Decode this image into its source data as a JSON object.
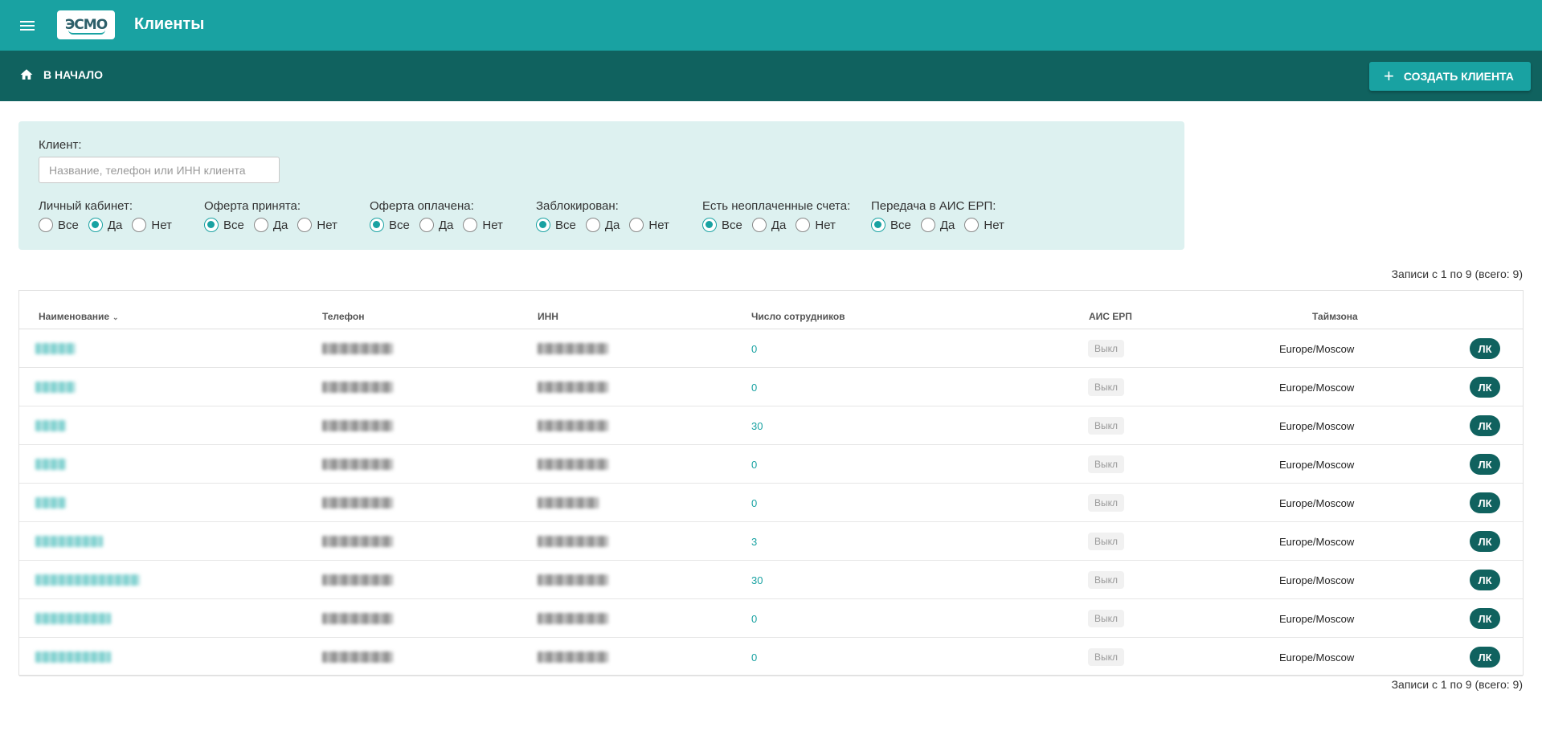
{
  "app": {
    "title": "Клиенты",
    "logo_text": "ЭСМО"
  },
  "nav": {
    "home_label": "В НАЧАЛО",
    "create_label": "СОЗДАТЬ КЛИЕНТА"
  },
  "filters": {
    "client_label": "Клиент:",
    "client_placeholder": "Название, телефон или ИНН клиента",
    "client_value": "",
    "groups": [
      {
        "label": "Личный кабинет:",
        "options": [
          "Все",
          "Да",
          "Нет"
        ],
        "selected": "Да"
      },
      {
        "label": "Оферта принята:",
        "options": [
          "Все",
          "Да",
          "Нет"
        ],
        "selected": "Все"
      },
      {
        "label": "Оферта оплачена:",
        "options": [
          "Все",
          "Да",
          "Нет"
        ],
        "selected": "Все"
      },
      {
        "label": "Заблокирован:",
        "options": [
          "Все",
          "Да",
          "Нет"
        ],
        "selected": "Все"
      },
      {
        "label": "Есть неоплаченные счета:",
        "options": [
          "Все",
          "Да",
          "Нет"
        ],
        "selected": "Все"
      },
      {
        "label": "Передача в АИС ЕРП:",
        "options": [
          "Все",
          "Да",
          "Нет"
        ],
        "selected": "Все"
      }
    ]
  },
  "records_info": "Записи с 1 по 9 (всего: 9)",
  "table": {
    "columns": {
      "name": "Наименование",
      "phone": "Телефон",
      "inn": "ИНН",
      "employees": "Число сотрудников",
      "erp": "АИС ЕРП",
      "timezone": "Таймзона"
    },
    "rows": [
      {
        "employees": "0",
        "erp": "Выкл",
        "timezone": "Europe/Moscow",
        "action": "ЛК"
      },
      {
        "employees": "0",
        "erp": "Выкл",
        "timezone": "Europe/Moscow",
        "action": "ЛК"
      },
      {
        "employees": "30",
        "erp": "Выкл",
        "timezone": "Europe/Moscow",
        "action": "ЛК"
      },
      {
        "employees": "0",
        "erp": "Выкл",
        "timezone": "Europe/Moscow",
        "action": "ЛК"
      },
      {
        "employees": "0",
        "erp": "Выкл",
        "timezone": "Europe/Moscow",
        "action": "ЛК"
      },
      {
        "employees": "3",
        "erp": "Выкл",
        "timezone": "Europe/Moscow",
        "action": "ЛК"
      },
      {
        "employees": "30",
        "erp": "Выкл",
        "timezone": "Europe/Moscow",
        "action": "ЛК"
      },
      {
        "employees": "0",
        "erp": "Выкл",
        "timezone": "Europe/Moscow",
        "action": "ЛК"
      },
      {
        "employees": "0",
        "erp": "Выкл",
        "timezone": "Europe/Moscow",
        "action": "ЛК"
      }
    ]
  },
  "colors": {
    "primary": "#19a2a2",
    "primary_dark": "#10625f",
    "filter_bg": "#ddf1f0"
  }
}
